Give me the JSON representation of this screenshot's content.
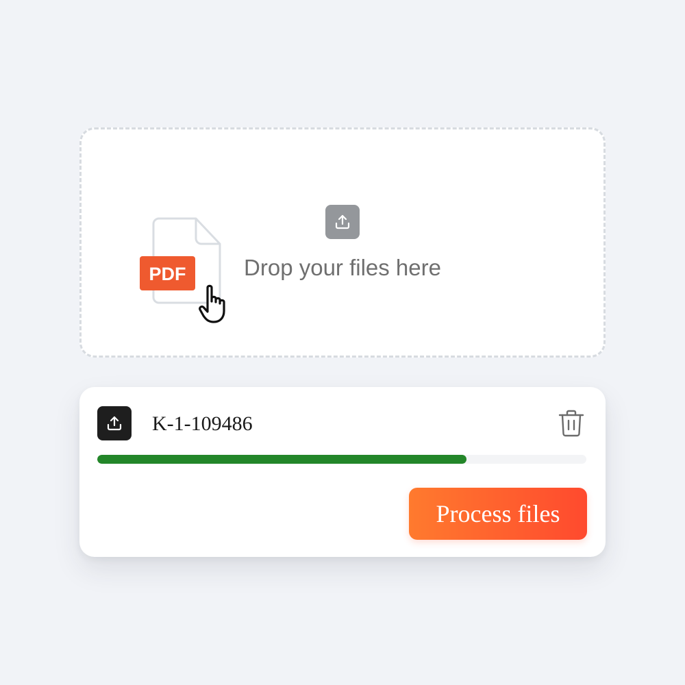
{
  "dropzone": {
    "prompt": "Drop your files here",
    "upload_icon": "upload-icon",
    "illustration": {
      "document_icon": "document-icon",
      "badge_label": "PDF",
      "badge_color": "#ef5a2f",
      "cursor_icon": "pointer-hand-icon"
    }
  },
  "file_item": {
    "icon": "upload-icon",
    "name": "K-1-109486",
    "delete_icon": "trash-icon",
    "progress": 0.755,
    "progress_color": "#238629"
  },
  "actions": {
    "process_label": "Process files",
    "process_gradient": [
      "#ff7a2e",
      "#ff4a2e"
    ]
  },
  "colors": {
    "background": "#f1f3f7",
    "card": "#ffffff",
    "dash_border": "#d7dbe0"
  }
}
